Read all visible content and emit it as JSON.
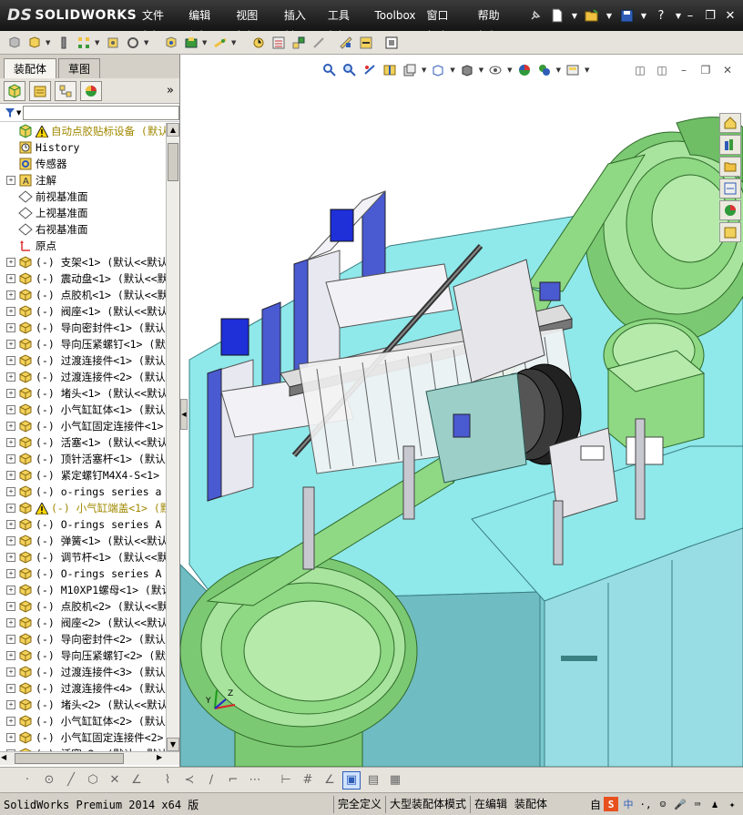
{
  "app": {
    "logo_text": "SOLIDWORKS",
    "logo_ds": "DS"
  },
  "menu": [
    "文件(F)",
    "编辑(E)",
    "视图(V)",
    "插入(I)",
    "工具(T)",
    "Toolbox",
    "窗口(W)",
    "帮助(H)"
  ],
  "panel": {
    "tabs": [
      "装配体",
      "草图"
    ],
    "active_tab": "装配体",
    "expand_label": "»"
  },
  "tree": [
    {
      "label": "自动点胶贴标设备 (默认<",
      "icon": "assembly-icon",
      "type": "root",
      "expander": "",
      "warn": true
    },
    {
      "label": "History",
      "icon": "history-icon",
      "type": "item",
      "expander": ""
    },
    {
      "label": "传感器",
      "icon": "sensor-icon",
      "type": "item",
      "expander": ""
    },
    {
      "label": "注解",
      "icon": "annotation-icon",
      "type": "item",
      "expander": "+"
    },
    {
      "label": "前视基准面",
      "icon": "plane-icon",
      "type": "item",
      "expander": ""
    },
    {
      "label": "上视基准面",
      "icon": "plane-icon",
      "type": "item",
      "expander": ""
    },
    {
      "label": "右视基准面",
      "icon": "plane-icon",
      "type": "item",
      "expander": ""
    },
    {
      "label": "原点",
      "icon": "origin-icon",
      "type": "item",
      "expander": ""
    },
    {
      "label": "(-) 支架<1> (默认<<默认",
      "icon": "part-icon",
      "type": "part",
      "expander": "+"
    },
    {
      "label": "(-) 震动盘<1> (默认<<默",
      "icon": "part-icon",
      "type": "part",
      "expander": "+"
    },
    {
      "label": "(-) 点胶机<1> (默认<<默",
      "icon": "part-icon",
      "type": "part",
      "expander": "+"
    },
    {
      "label": "(-) 阀座<1> (默认<<默认",
      "icon": "part-icon",
      "type": "part",
      "expander": "+"
    },
    {
      "label": "(-) 导向密封件<1> (默认",
      "icon": "part-icon",
      "type": "part",
      "expander": "+"
    },
    {
      "label": "(-) 导向压紧螺钉<1> (默",
      "icon": "part-icon",
      "type": "part",
      "expander": "+"
    },
    {
      "label": "(-) 过渡连接件<1> (默认",
      "icon": "part-icon",
      "type": "part",
      "expander": "+"
    },
    {
      "label": "(-) 过渡连接件<2> (默认",
      "icon": "part-icon",
      "type": "part",
      "expander": "+"
    },
    {
      "label": "(-) 堵头<1> (默认<<默认",
      "icon": "part-icon",
      "type": "part",
      "expander": "+"
    },
    {
      "label": "(-) 小气缸缸体<1> (默认",
      "icon": "part-icon",
      "type": "part",
      "expander": "+"
    },
    {
      "label": "(-) 小气缸固定连接件<1>",
      "icon": "part-icon",
      "type": "part",
      "expander": "+"
    },
    {
      "label": "(-) 活塞<1> (默认<<默认",
      "icon": "part-icon",
      "type": "part",
      "expander": "+"
    },
    {
      "label": "(-) 顶针活塞杆<1> (默认",
      "icon": "part-icon",
      "type": "part",
      "expander": "+"
    },
    {
      "label": "(-) 紧定螺钉M4X4-S<1> (",
      "icon": "part-icon",
      "type": "part",
      "expander": "+"
    },
    {
      "label": "(-) o-rings series a gb",
      "icon": "part-icon",
      "type": "part",
      "expander": "+"
    },
    {
      "label": "(-) 小气缸端盖<1> (默",
      "icon": "part-icon",
      "type": "part",
      "expander": "+",
      "warn": true
    },
    {
      "label": "(-) O-rings series A GB",
      "icon": "part-icon",
      "type": "part",
      "expander": "+"
    },
    {
      "label": "(-) 弹簧<1> (默认<<默认",
      "icon": "part-icon",
      "type": "part",
      "expander": "+"
    },
    {
      "label": "(-) 调节杆<1> (默认<<默",
      "icon": "part-icon",
      "type": "part",
      "expander": "+"
    },
    {
      "label": "(-) O-rings series A GB",
      "icon": "part-icon",
      "type": "part",
      "expander": "+"
    },
    {
      "label": "(-) M10XP1螺母<1> (默认",
      "icon": "part-icon",
      "type": "part",
      "expander": "+"
    },
    {
      "label": "(-) 点胶机<2> (默认<<默",
      "icon": "part-icon",
      "type": "part",
      "expander": "+"
    },
    {
      "label": "(-) 阀座<2> (默认<<默认",
      "icon": "part-icon",
      "type": "part",
      "expander": "+"
    },
    {
      "label": "(-) 导向密封件<2> (默认",
      "icon": "part-icon",
      "type": "part",
      "expander": "+"
    },
    {
      "label": "(-) 导向压紧螺钉<2> (默",
      "icon": "part-icon",
      "type": "part",
      "expander": "+"
    },
    {
      "label": "(-) 过渡连接件<3> (默认",
      "icon": "part-icon",
      "type": "part",
      "expander": "+"
    },
    {
      "label": "(-) 过渡连接件<4> (默认",
      "icon": "part-icon",
      "type": "part",
      "expander": "+"
    },
    {
      "label": "(-) 堵头<2> (默认<<默认",
      "icon": "part-icon",
      "type": "part",
      "expander": "+"
    },
    {
      "label": "(-) 小气缸缸体<2> (默认",
      "icon": "part-icon",
      "type": "part",
      "expander": "+"
    },
    {
      "label": "(-) 小气缸固定连接件<2>",
      "icon": "part-icon",
      "type": "part",
      "expander": "+"
    },
    {
      "label": "(-) 活塞<2> (默认<<默认",
      "icon": "part-icon",
      "type": "part",
      "expander": "+"
    }
  ],
  "status": {
    "product": "SolidWorks Premium 2014 x64 版",
    "fields": [
      "完全定义",
      "大型装配体模式",
      "在编辑",
      "装配体"
    ],
    "ime_prefix": "自",
    "ime_mode": "中"
  },
  "colors": {
    "title_bg": "#1d1d1d",
    "machine_base": "#8fe8ea",
    "bowl_green": "#8fd884",
    "cabinet": "#99dde4"
  }
}
